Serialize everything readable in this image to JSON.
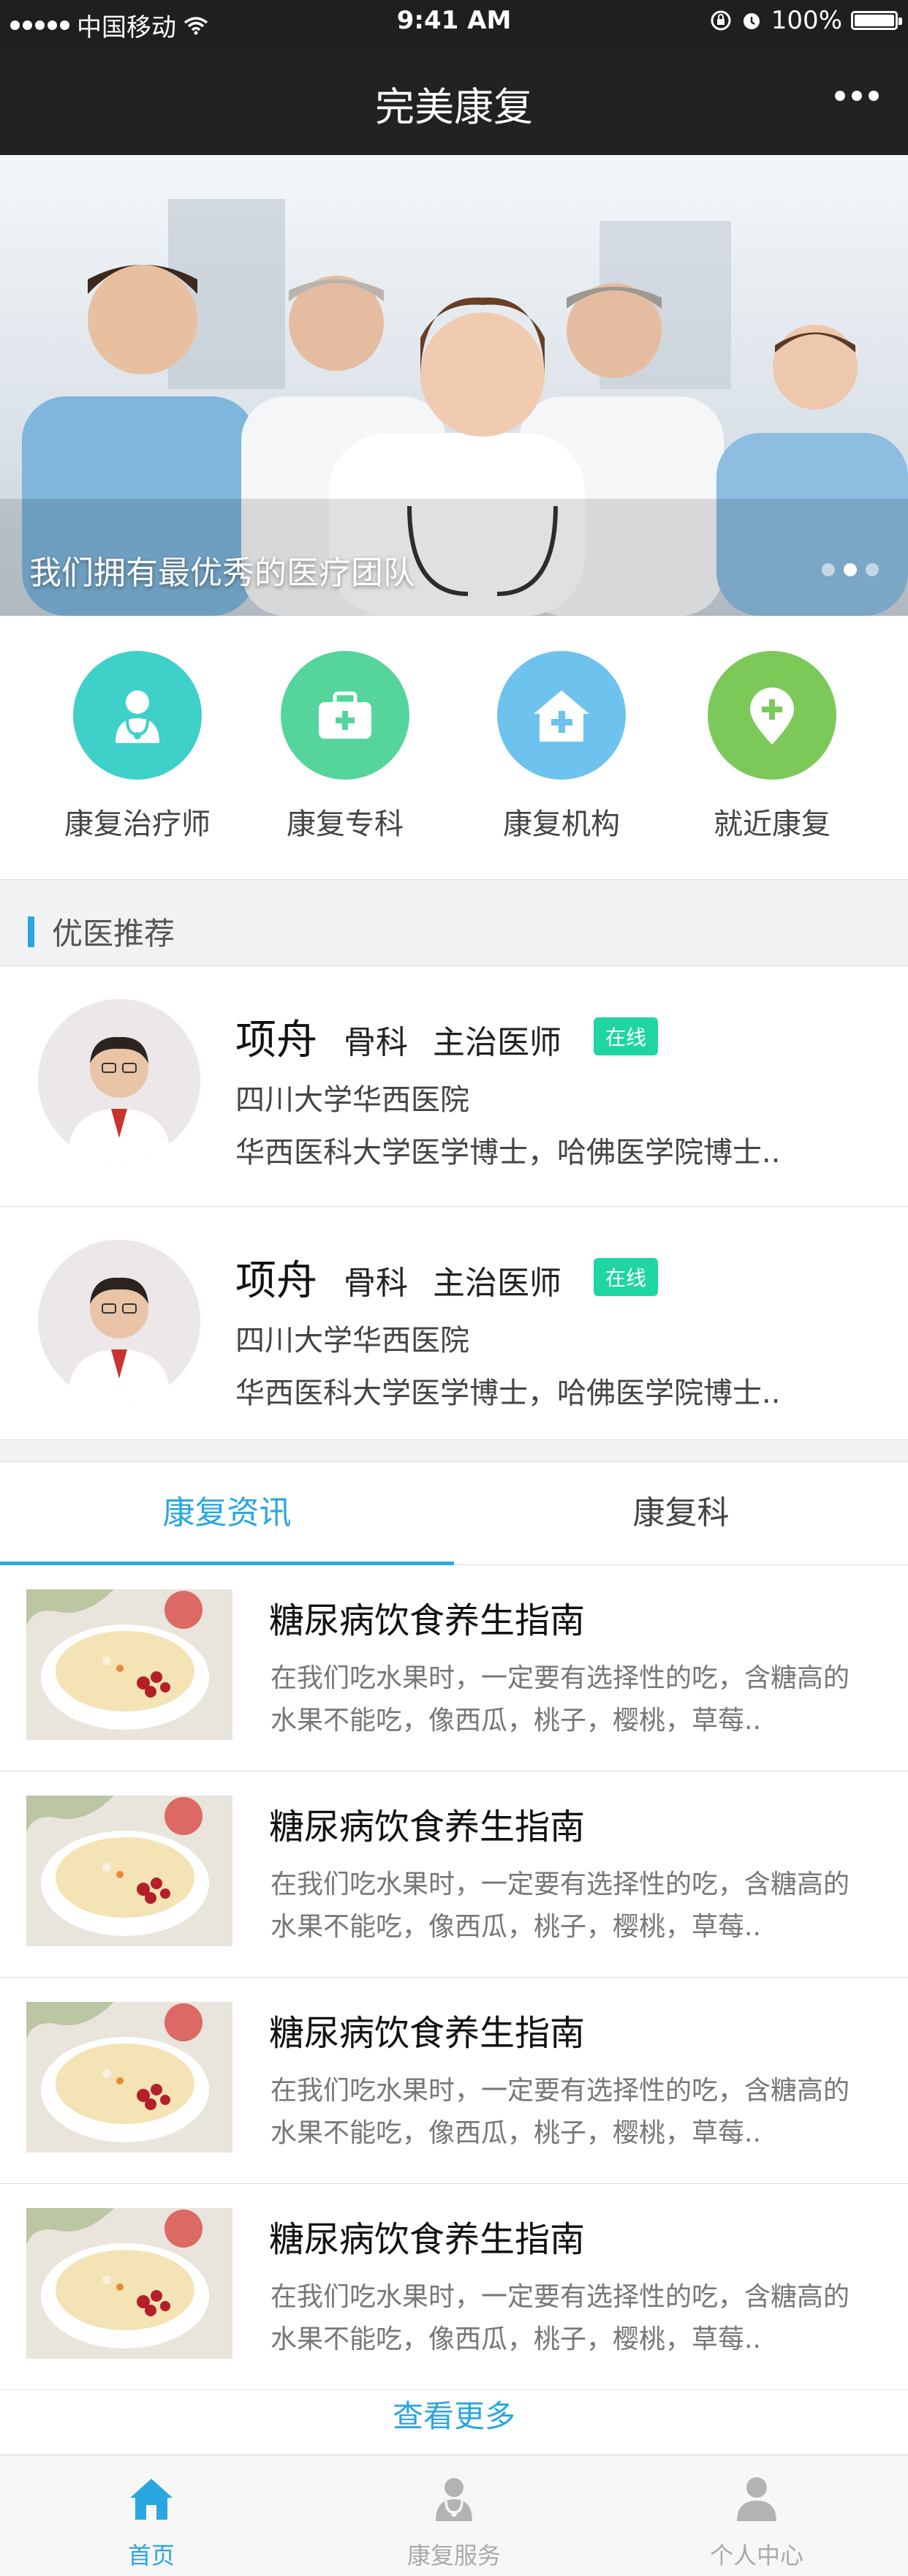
{
  "status_bar": {
    "carrier": "中国移动",
    "time": "9:41 AM",
    "battery": "100%",
    "battery_level": 1.0
  },
  "header": {
    "title": "完美康复"
  },
  "banner": {
    "caption": "我们拥有最优秀的医疗团队",
    "slide_count": 3,
    "active_slide": 2
  },
  "quick_links": [
    {
      "label": "康复治疗师",
      "icon": "doctor-icon",
      "color": "#3fd0c9"
    },
    {
      "label": "康复专科",
      "icon": "medical-kit-icon",
      "color": "#55d49c"
    },
    {
      "label": "康复机构",
      "icon": "hospital-icon",
      "color": "#6ec2ee"
    },
    {
      "label": "就近康复",
      "icon": "location-pin-icon",
      "color": "#7cc95a"
    }
  ],
  "recommend": {
    "title": "优医推荐"
  },
  "doctors": [
    {
      "name": "项舟",
      "dept": "骨科",
      "title": "主治医师",
      "status": "在线",
      "hospital": "四川大学华西医院",
      "desc": "华西医科大学医学博士，哈佛医学院博士.."
    },
    {
      "name": "项舟",
      "dept": "骨科",
      "title": "主治医师",
      "status": "在线",
      "hospital": "四川大学华西医院",
      "desc": "华西医科大学医学博士，哈佛医学院博士.."
    }
  ],
  "tabs": [
    {
      "label": "康复资讯",
      "active": true
    },
    {
      "label": "康复科",
      "active": false
    }
  ],
  "articles": [
    {
      "title": "糖尿病饮食养生指南",
      "desc": "在我们吃水果时，一定要有选择性的吃，含糖高的水果不能吃，像西瓜，桃子，樱桃，草莓.."
    },
    {
      "title": "糖尿病饮食养生指南",
      "desc": "在我们吃水果时，一定要有选择性的吃，含糖高的水果不能吃，像西瓜，桃子，樱桃，草莓.."
    },
    {
      "title": "糖尿病饮食养生指南",
      "desc": "在我们吃水果时，一定要有选择性的吃，含糖高的水果不能吃，像西瓜，桃子，樱桃，草莓.."
    },
    {
      "title": "糖尿病饮食养生指南",
      "desc": "在我们吃水果时，一定要有选择性的吃，含糖高的水果不能吃，像西瓜，桃子，樱桃，草莓.."
    }
  ],
  "more_link": "查看更多",
  "tabbar": [
    {
      "label": "首页",
      "icon": "home-icon",
      "active": true
    },
    {
      "label": "康复服务",
      "icon": "doctor-icon",
      "active": false
    },
    {
      "label": "个人中心",
      "icon": "user-icon",
      "active": false
    }
  ],
  "colors": {
    "accent": "#2aa6e0",
    "online_badge": "#1fd6a2",
    "nav_bg": "#222222"
  }
}
